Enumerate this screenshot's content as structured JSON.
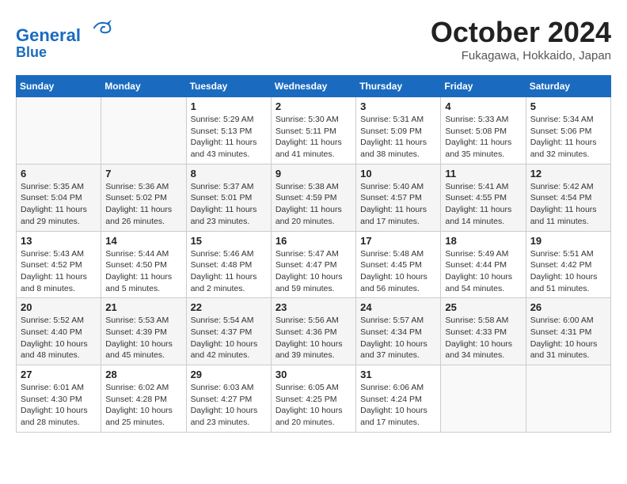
{
  "header": {
    "logo_line1": "General",
    "logo_line2": "Blue",
    "month_title": "October 2024",
    "location": "Fukagawa, Hokkaido, Japan"
  },
  "weekdays": [
    "Sunday",
    "Monday",
    "Tuesday",
    "Wednesday",
    "Thursday",
    "Friday",
    "Saturday"
  ],
  "weeks": [
    [
      {
        "day": "",
        "sunrise": "",
        "sunset": "",
        "daylight": ""
      },
      {
        "day": "",
        "sunrise": "",
        "sunset": "",
        "daylight": ""
      },
      {
        "day": "1",
        "sunrise": "Sunrise: 5:29 AM",
        "sunset": "Sunset: 5:13 PM",
        "daylight": "Daylight: 11 hours and 43 minutes."
      },
      {
        "day": "2",
        "sunrise": "Sunrise: 5:30 AM",
        "sunset": "Sunset: 5:11 PM",
        "daylight": "Daylight: 11 hours and 41 minutes."
      },
      {
        "day": "3",
        "sunrise": "Sunrise: 5:31 AM",
        "sunset": "Sunset: 5:09 PM",
        "daylight": "Daylight: 11 hours and 38 minutes."
      },
      {
        "day": "4",
        "sunrise": "Sunrise: 5:33 AM",
        "sunset": "Sunset: 5:08 PM",
        "daylight": "Daylight: 11 hours and 35 minutes."
      },
      {
        "day": "5",
        "sunrise": "Sunrise: 5:34 AM",
        "sunset": "Sunset: 5:06 PM",
        "daylight": "Daylight: 11 hours and 32 minutes."
      }
    ],
    [
      {
        "day": "6",
        "sunrise": "Sunrise: 5:35 AM",
        "sunset": "Sunset: 5:04 PM",
        "daylight": "Daylight: 11 hours and 29 minutes."
      },
      {
        "day": "7",
        "sunrise": "Sunrise: 5:36 AM",
        "sunset": "Sunset: 5:02 PM",
        "daylight": "Daylight: 11 hours and 26 minutes."
      },
      {
        "day": "8",
        "sunrise": "Sunrise: 5:37 AM",
        "sunset": "Sunset: 5:01 PM",
        "daylight": "Daylight: 11 hours and 23 minutes."
      },
      {
        "day": "9",
        "sunrise": "Sunrise: 5:38 AM",
        "sunset": "Sunset: 4:59 PM",
        "daylight": "Daylight: 11 hours and 20 minutes."
      },
      {
        "day": "10",
        "sunrise": "Sunrise: 5:40 AM",
        "sunset": "Sunset: 4:57 PM",
        "daylight": "Daylight: 11 hours and 17 minutes."
      },
      {
        "day": "11",
        "sunrise": "Sunrise: 5:41 AM",
        "sunset": "Sunset: 4:55 PM",
        "daylight": "Daylight: 11 hours and 14 minutes."
      },
      {
        "day": "12",
        "sunrise": "Sunrise: 5:42 AM",
        "sunset": "Sunset: 4:54 PM",
        "daylight": "Daylight: 11 hours and 11 minutes."
      }
    ],
    [
      {
        "day": "13",
        "sunrise": "Sunrise: 5:43 AM",
        "sunset": "Sunset: 4:52 PM",
        "daylight": "Daylight: 11 hours and 8 minutes."
      },
      {
        "day": "14",
        "sunrise": "Sunrise: 5:44 AM",
        "sunset": "Sunset: 4:50 PM",
        "daylight": "Daylight: 11 hours and 5 minutes."
      },
      {
        "day": "15",
        "sunrise": "Sunrise: 5:46 AM",
        "sunset": "Sunset: 4:48 PM",
        "daylight": "Daylight: 11 hours and 2 minutes."
      },
      {
        "day": "16",
        "sunrise": "Sunrise: 5:47 AM",
        "sunset": "Sunset: 4:47 PM",
        "daylight": "Daylight: 10 hours and 59 minutes."
      },
      {
        "day": "17",
        "sunrise": "Sunrise: 5:48 AM",
        "sunset": "Sunset: 4:45 PM",
        "daylight": "Daylight: 10 hours and 56 minutes."
      },
      {
        "day": "18",
        "sunrise": "Sunrise: 5:49 AM",
        "sunset": "Sunset: 4:44 PM",
        "daylight": "Daylight: 10 hours and 54 minutes."
      },
      {
        "day": "19",
        "sunrise": "Sunrise: 5:51 AM",
        "sunset": "Sunset: 4:42 PM",
        "daylight": "Daylight: 10 hours and 51 minutes."
      }
    ],
    [
      {
        "day": "20",
        "sunrise": "Sunrise: 5:52 AM",
        "sunset": "Sunset: 4:40 PM",
        "daylight": "Daylight: 10 hours and 48 minutes."
      },
      {
        "day": "21",
        "sunrise": "Sunrise: 5:53 AM",
        "sunset": "Sunset: 4:39 PM",
        "daylight": "Daylight: 10 hours and 45 minutes."
      },
      {
        "day": "22",
        "sunrise": "Sunrise: 5:54 AM",
        "sunset": "Sunset: 4:37 PM",
        "daylight": "Daylight: 10 hours and 42 minutes."
      },
      {
        "day": "23",
        "sunrise": "Sunrise: 5:56 AM",
        "sunset": "Sunset: 4:36 PM",
        "daylight": "Daylight: 10 hours and 39 minutes."
      },
      {
        "day": "24",
        "sunrise": "Sunrise: 5:57 AM",
        "sunset": "Sunset: 4:34 PM",
        "daylight": "Daylight: 10 hours and 37 minutes."
      },
      {
        "day": "25",
        "sunrise": "Sunrise: 5:58 AM",
        "sunset": "Sunset: 4:33 PM",
        "daylight": "Daylight: 10 hours and 34 minutes."
      },
      {
        "day": "26",
        "sunrise": "Sunrise: 6:00 AM",
        "sunset": "Sunset: 4:31 PM",
        "daylight": "Daylight: 10 hours and 31 minutes."
      }
    ],
    [
      {
        "day": "27",
        "sunrise": "Sunrise: 6:01 AM",
        "sunset": "Sunset: 4:30 PM",
        "daylight": "Daylight: 10 hours and 28 minutes."
      },
      {
        "day": "28",
        "sunrise": "Sunrise: 6:02 AM",
        "sunset": "Sunset: 4:28 PM",
        "daylight": "Daylight: 10 hours and 25 minutes."
      },
      {
        "day": "29",
        "sunrise": "Sunrise: 6:03 AM",
        "sunset": "Sunset: 4:27 PM",
        "daylight": "Daylight: 10 hours and 23 minutes."
      },
      {
        "day": "30",
        "sunrise": "Sunrise: 6:05 AM",
        "sunset": "Sunset: 4:25 PM",
        "daylight": "Daylight: 10 hours and 20 minutes."
      },
      {
        "day": "31",
        "sunrise": "Sunrise: 6:06 AM",
        "sunset": "Sunset: 4:24 PM",
        "daylight": "Daylight: 10 hours and 17 minutes."
      },
      {
        "day": "",
        "sunrise": "",
        "sunset": "",
        "daylight": ""
      },
      {
        "day": "",
        "sunrise": "",
        "sunset": "",
        "daylight": ""
      }
    ]
  ]
}
